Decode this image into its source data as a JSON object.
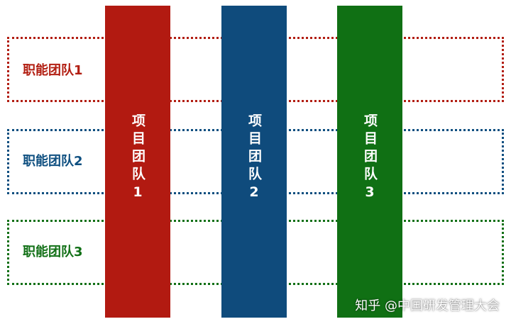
{
  "functional_teams": [
    {
      "label": "职能团队1",
      "color": "#b21e12"
    },
    {
      "label": "职能团队2",
      "color": "#0e4f80"
    },
    {
      "label": "职能团队3",
      "color": "#117016"
    }
  ],
  "project_teams": [
    {
      "label": "项目团队1",
      "color": "#b21a11"
    },
    {
      "label": "项目团队2",
      "color": "#0f4b7c"
    },
    {
      "label": "项目团队3",
      "color": "#107014"
    }
  ],
  "watermark": "知乎 @中国研发管理大会"
}
